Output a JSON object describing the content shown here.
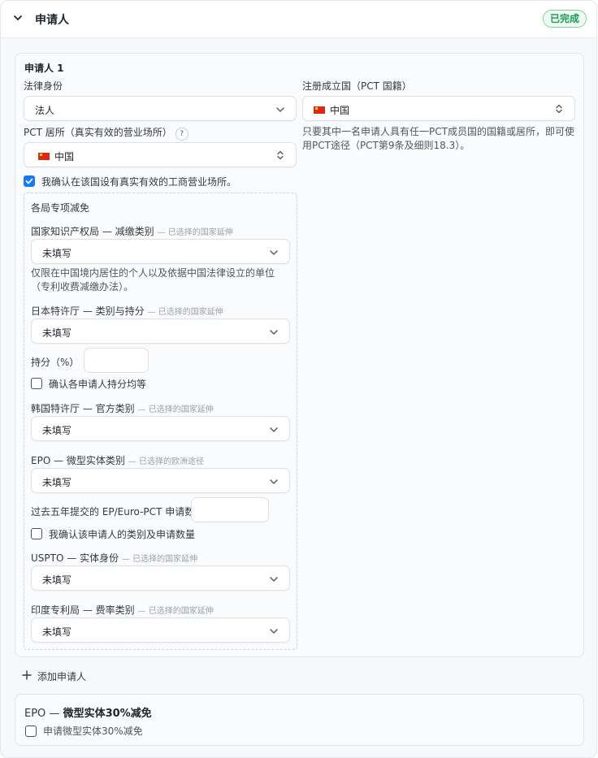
{
  "header": {
    "title": "申请人",
    "status_badge": "已完成"
  },
  "applicant": {
    "title": "申请人 1",
    "legal_status": {
      "label": "法律身份",
      "value": "法人"
    },
    "registration_country": {
      "label": "注册成立国（PCT 国籍）",
      "value": "中国"
    },
    "pct_residence": {
      "label": "PCT 居所（真实有效的营业场所）",
      "help": "?",
      "value": "中国"
    },
    "pct_note": "只要其中一名申请人具有任一PCT成员国的国籍或居所，即可使用PCT途径（PCT第9条及细则18.3）。",
    "confirm_business": "我确认在该国设有真实有效的工商营业场所。",
    "reductions": {
      "title": "各局专项减免",
      "cnipa": {
        "office": "国家知识产权局",
        "sep": "—",
        "field": "减缴类别",
        "tag": "— 已选择的国家延伸",
        "value": "未填写",
        "note": "仅限在中国境内居住的个人以及依据中国法律设立的单位（专利收费减缴办法）。"
      },
      "jpo": {
        "office": "日本特许厅",
        "sep": "—",
        "field": "类别与持分",
        "tag": "— 已选择的国家延伸",
        "value": "未填写",
        "share_label": "持分（%）",
        "confirm": "确认各申请人持分均等"
      },
      "kipo": {
        "office": "韩国特许厅",
        "sep": "—",
        "field": "官方类别",
        "tag": "— 已选择的国家延伸",
        "value": "未填写"
      },
      "epo": {
        "office": "EPO",
        "sep": "—",
        "field": "微型实体类别",
        "tag": "— 已选择的欧洲途径",
        "value": "未填写",
        "count_label": "过去五年提交的 EP/Euro-PCT 申请数",
        "confirm": "我确认该申请人的类别及申请数量"
      },
      "uspto": {
        "office": "USPTO",
        "sep": "—",
        "field": "实体身份",
        "tag": "— 已选择的国家延伸",
        "value": "未填写"
      },
      "ipo": {
        "office": "印度专利局",
        "sep": "—",
        "field": "费率类别",
        "tag": "— 已选择的国家延伸",
        "value": "未填写"
      }
    }
  },
  "add_applicant": "添加申请人",
  "epo_micro": {
    "title_prefix": "EPO —",
    "title_bold": "微型实体30%减免",
    "checkbox": "申请微型实体30%减免"
  },
  "colors": {
    "accent": "#1677ff",
    "badge_green": "#1e9a55"
  }
}
